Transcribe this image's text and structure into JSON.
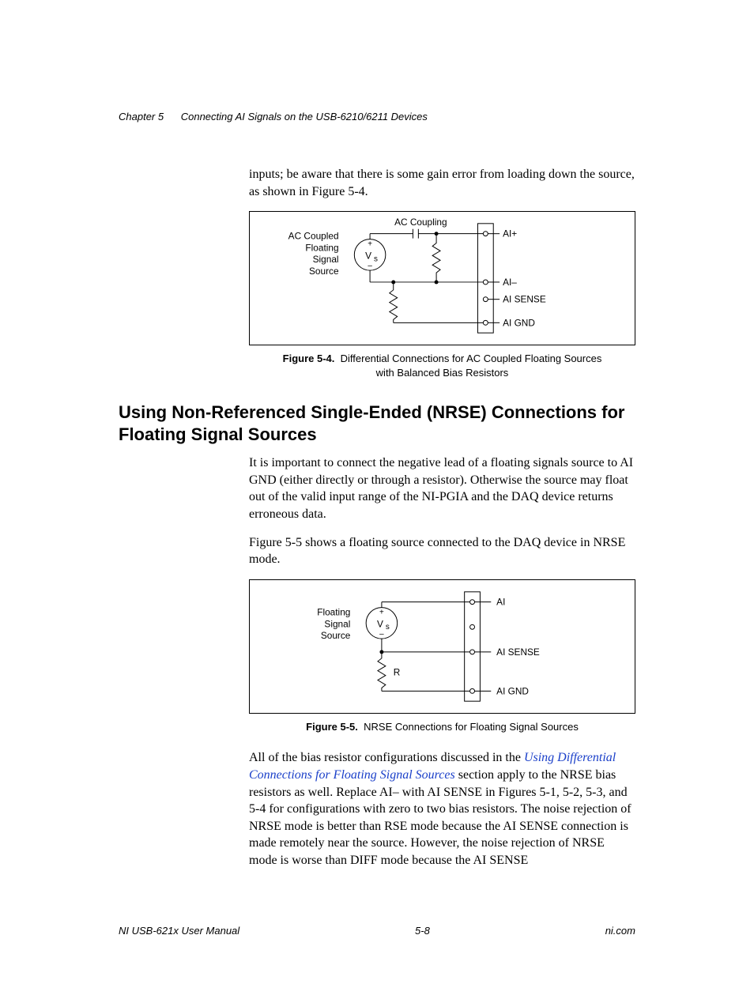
{
  "header": {
    "chapter": "Chapter 5",
    "title": "Connecting AI Signals on the USB-6210/6211 Devices"
  },
  "para_intro": "inputs; be aware that there is some gain error from loading down the source, as shown in Figure 5-4.",
  "fig54": {
    "caption_label": "Figure 5-4.",
    "caption_text_line1": "Differential Connections for AC Coupled Floating Sources",
    "caption_text_line2": "with Balanced Bias Resistors",
    "labels": {
      "source_l1": "AC Coupled",
      "source_l2": "Floating",
      "source_l3": "Signal",
      "source_l4": "Source",
      "ac_coupling": "AC Coupling",
      "vs_plus": "+",
      "vs": "V",
      "vs_sub": "s",
      "vs_minus": "–",
      "ai_plus": "AI+",
      "ai_minus": "AI–",
      "ai_sense": "AI SENSE",
      "ai_gnd": "AI GND"
    }
  },
  "section_heading": "Using Non-Referenced Single-Ended (NRSE) Connections for Floating Signal Sources",
  "para_nrse1": "It is important to connect the negative lead of a floating signals source to AI GND (either directly or through a resistor). Otherwise the source may float out of the valid input range of the NI-PGIA and the DAQ device returns erroneous data.",
  "para_nrse2": "Figure 5-5 shows a floating source connected to the DAQ device in NRSE mode.",
  "fig55": {
    "caption_label": "Figure 5-5.",
    "caption_text": "NRSE Connections for Floating Signal Sources",
    "labels": {
      "source_l1": "Floating",
      "source_l2": "Signal",
      "source_l3": "Source",
      "vs_plus": "+",
      "vs": "V",
      "vs_sub": "s",
      "vs_minus": "–",
      "r": "R",
      "ai": "AI",
      "ai_sense": "AI SENSE",
      "ai_gnd": "AI GND"
    }
  },
  "para_last_pre": "All of the bias resistor configurations discussed in the ",
  "xref": "Using Differential Connections for Floating Signal Sources",
  "para_last_post": " section apply to the NRSE bias resistors as well. Replace AI– with AI SENSE in Figures 5-1, 5-2, 5-3, and 5-4 for configurations with zero to two bias resistors. The noise rejection of NRSE mode is better than RSE mode because the AI SENSE connection is made remotely near the source. However, the noise rejection of NRSE mode is worse than DIFF mode because the AI SENSE",
  "footer": {
    "left": "NI USB-621x User Manual",
    "center": "5-8",
    "right": "ni.com"
  }
}
